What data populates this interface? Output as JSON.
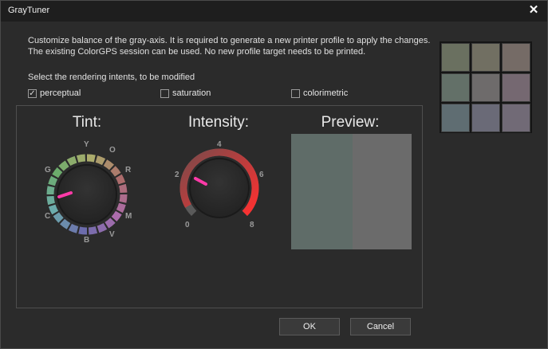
{
  "window": {
    "title": "GrayTuner",
    "close_glyph": "✕"
  },
  "description": {
    "line1": "Customize balance of the gray-axis. It is required to generate a new printer profile to apply the changes.",
    "line2": "The existing ColorGPS session can be used. No new profile target needs to be printed."
  },
  "intents": {
    "label": "Select the rendering intents, to be modified",
    "options": [
      {
        "label": "perceptual",
        "checked": true
      },
      {
        "label": "saturation",
        "checked": false
      },
      {
        "label": "colorimetric",
        "checked": false
      }
    ]
  },
  "swatch_colors": [
    "#6a7060",
    "#716f62",
    "#756b66",
    "#637068",
    "#6e6b6b",
    "#756871",
    "#5f6d72",
    "#6a6a77",
    "#716a76"
  ],
  "tint": {
    "title": "Tint:",
    "labels": [
      "Y",
      "O",
      "R",
      "M",
      "V",
      "B",
      "C",
      "G"
    ]
  },
  "intensity": {
    "title": "Intensity:",
    "labels": [
      "0",
      "2",
      "4",
      "6",
      "8"
    ]
  },
  "preview": {
    "title": "Preview:",
    "original_color": "#5f6c68",
    "adjusted_color": "#6b6b6b"
  },
  "buttons": {
    "ok": "OK",
    "cancel": "Cancel"
  }
}
